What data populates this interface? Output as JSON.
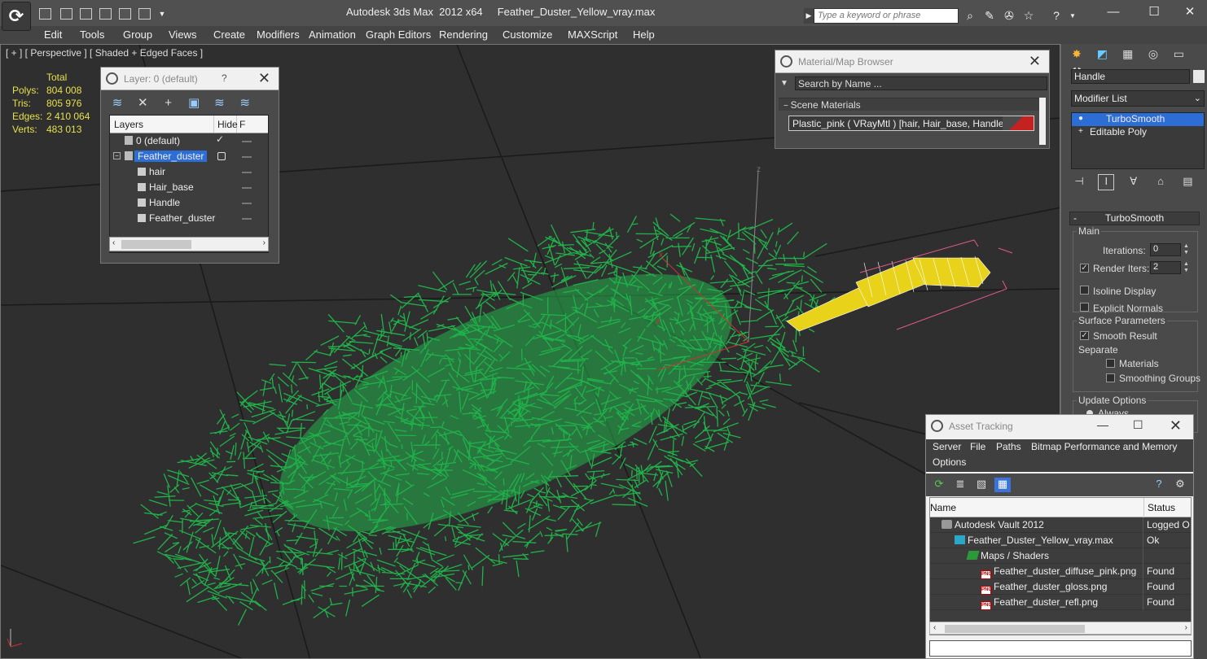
{
  "window": {
    "app_title": "Autodesk 3ds Max  2012 x64     Feather_Duster_Yellow_vray.max",
    "search_placeholder": "Type a keyword or phrase"
  },
  "menu": [
    "Edit",
    "Tools",
    "Group",
    "Views",
    "Create",
    "Modifiers",
    "Animation",
    "Graph Editors",
    "Rendering",
    "Customize",
    "MAXScript",
    "Help"
  ],
  "viewport": {
    "label": "[ + ] [ Perspective ] [ Shaded + Edged Faces ]",
    "stats": {
      "header": "Total",
      "rows": [
        {
          "label": "Polys:",
          "value": "804 008"
        },
        {
          "label": "Tris:",
          "value": "805 976"
        },
        {
          "label": "Edges:",
          "value": "2 410 064"
        },
        {
          "label": "Verts:",
          "value": "483 013"
        }
      ]
    },
    "axis": {
      "x": "x",
      "y": "y",
      "z": "z"
    },
    "colors": {
      "fur": "#21b24a",
      "handle": "#e8d21a",
      "grid": "#1a1a1a",
      "bounds": "#e05a8a"
    }
  },
  "layers": {
    "title": "Layer: 0 (default)",
    "help": "?",
    "columns": {
      "name": "Layers",
      "hide": "Hide",
      "freeze": "F"
    },
    "rows": [
      {
        "name": "0 (default)",
        "indent": 0,
        "selected": false,
        "current": true
      },
      {
        "name": "Feather_duster",
        "indent": 0,
        "selected": true,
        "current": false
      },
      {
        "name": "hair",
        "indent": 1,
        "selected": false,
        "current": false
      },
      {
        "name": "Hair_base",
        "indent": 1,
        "selected": false,
        "current": false
      },
      {
        "name": "Handle",
        "indent": 1,
        "selected": false,
        "current": false
      },
      {
        "name": "Feather_duster",
        "indent": 1,
        "selected": false,
        "current": false
      }
    ]
  },
  "material_browser": {
    "title": "Material/Map Browser",
    "search_placeholder": "Search by Name ...",
    "group": "Scene Materials",
    "item": "Plastic_pink  ( VRayMtl )  [hair, Hair_base, Handle]",
    "swatch_color": "#c62121"
  },
  "command_panel": {
    "object_name": "Handle",
    "modifier_list": "Modifier List",
    "stack": [
      {
        "label": "TurboSmooth",
        "selected": true
      },
      {
        "label": "Editable Poly",
        "selected": false
      }
    ],
    "turbosmooth": {
      "title": "TurboSmooth",
      "main": "Main",
      "iterations_label": "Iterations:",
      "iterations": "0",
      "render_iters_label": "Render Iters:",
      "render_iters": "2",
      "isoline": "Isoline Display",
      "explicit_normals": "Explicit Normals",
      "surface_params": "Surface Parameters",
      "smooth_result": "Smooth Result",
      "separate": "Separate",
      "materials": "Materials",
      "smoothing_groups": "Smoothing Groups",
      "update_options": "Update Options",
      "always": "Always"
    }
  },
  "asset_tracking": {
    "title": "Asset Tracking",
    "menu": [
      "Server",
      "File",
      "Paths",
      "Bitmap Performance and Memory",
      "Options"
    ],
    "columns": {
      "name": "Name",
      "status": "Status"
    },
    "rows": [
      {
        "name": "Autodesk Vault 2012",
        "status": "Logged O",
        "indent": 1,
        "icon": "vault"
      },
      {
        "name": "Feather_Duster_Yellow_vray.max",
        "status": "Ok",
        "indent": 2,
        "icon": "max"
      },
      {
        "name": "Maps / Shaders",
        "status": "",
        "indent": 3,
        "icon": "map"
      },
      {
        "name": "Feather_duster_diffuse_pink.png",
        "status": "Found",
        "indent": 4,
        "icon": "png"
      },
      {
        "name": "Feather_duster_gloss.png",
        "status": "Found",
        "indent": 4,
        "icon": "png"
      },
      {
        "name": "Feather_duster_refl.png",
        "status": "Found",
        "indent": 4,
        "icon": "png"
      }
    ]
  }
}
